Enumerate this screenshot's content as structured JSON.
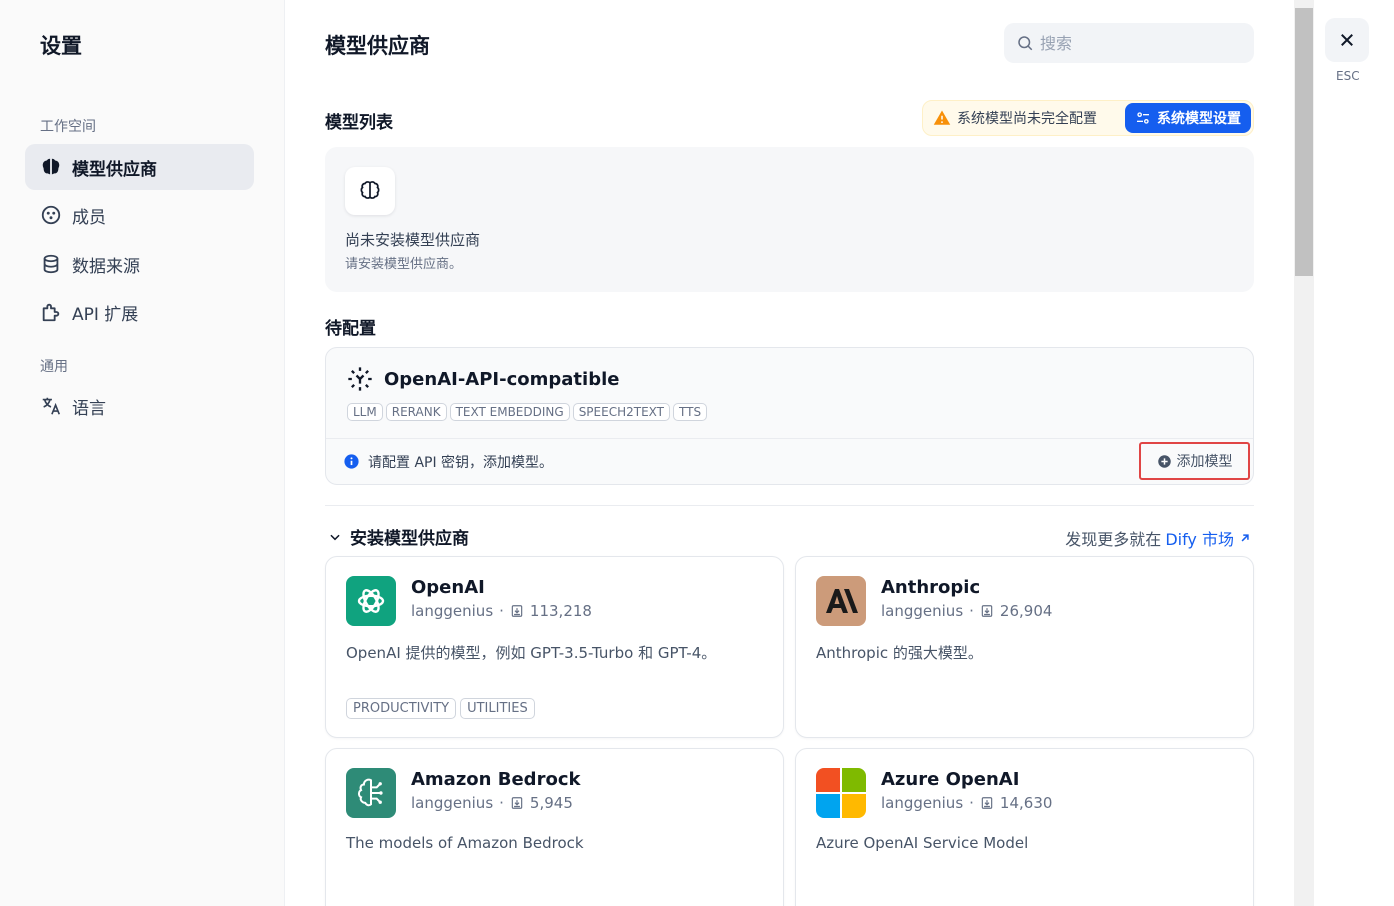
{
  "sidebar": {
    "title": "设置",
    "groups": [
      {
        "label": "工作空间"
      },
      {
        "label": "通用"
      }
    ],
    "items": [
      {
        "label": "模型供应商",
        "icon": "brain-icon"
      },
      {
        "label": "成员",
        "icon": "members-icon"
      },
      {
        "label": "数据来源",
        "icon": "database-icon"
      },
      {
        "label": "API 扩展",
        "icon": "puzzle-icon"
      },
      {
        "label": "语言",
        "icon": "translate-icon"
      }
    ]
  },
  "main": {
    "title": "模型供应商",
    "search": {
      "placeholder": "搜索"
    },
    "model_list": {
      "title": "模型列表",
      "warning": "系统模型尚未完全配置",
      "system_button": "系统模型设置",
      "empty_title": "尚未安装模型供应商",
      "empty_sub": "请安装模型供应商。"
    },
    "pending": {
      "title": "待配置",
      "provider_name": "OpenAI-API-compatible",
      "tags": [
        "LLM",
        "RERANK",
        "TEXT EMBEDDING",
        "SPEECH2TEXT",
        "TTS"
      ],
      "notice": "请配置 API 密钥，添加模型。",
      "add_button": "添加模型"
    },
    "install": {
      "title": "安装模型供应商",
      "market_prefix": "发现更多就在",
      "market_link": "Dify 市场",
      "plugins": [
        {
          "name": "OpenAI",
          "author": "langgenius",
          "downloads": "113,218",
          "desc": "OpenAI 提供的模型，例如 GPT-3.5-Turbo 和 GPT-4。",
          "tags": [
            "PRODUCTIVITY",
            "UTILITIES"
          ]
        },
        {
          "name": "Anthropic",
          "author": "langgenius",
          "downloads": "26,904",
          "desc": "Anthropic 的强大模型。",
          "tags": []
        },
        {
          "name": "Amazon Bedrock",
          "author": "langgenius",
          "downloads": "5,945",
          "desc": "The models of Amazon Bedrock",
          "tags": []
        },
        {
          "name": "Azure OpenAI",
          "author": "langgenius",
          "downloads": "14,630",
          "desc": "Azure OpenAI Service Model",
          "tags": []
        }
      ]
    }
  },
  "close": {
    "label": "ESC"
  },
  "colors": {
    "primary": "#155eef",
    "warning": "#f79009",
    "openai": "#10a37f",
    "anthropic": "#cc9b7a",
    "bedrock": "#2e8b77"
  }
}
